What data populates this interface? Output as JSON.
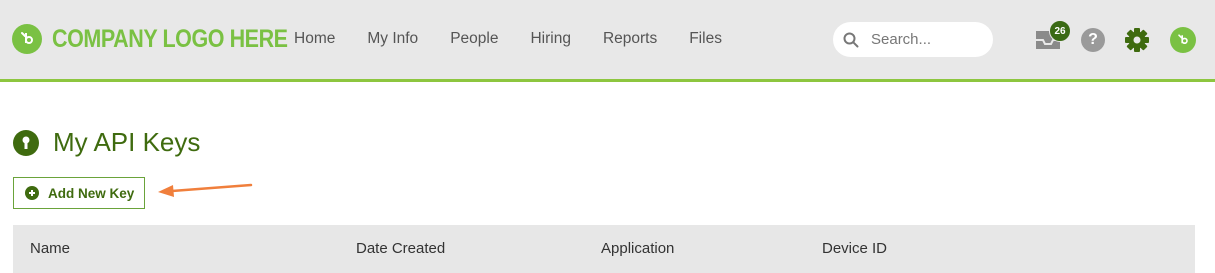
{
  "header": {
    "logo_text": "COMPANY LOGO HERE",
    "nav": [
      "Home",
      "My Info",
      "People",
      "Hiring",
      "Reports",
      "Files"
    ],
    "search_placeholder": "Search...",
    "inbox_count": "26",
    "help_label": "?"
  },
  "page": {
    "title": "My API Keys",
    "add_button_label": "Add New Key"
  },
  "table": {
    "columns": [
      "Name",
      "Date Created",
      "Application",
      "Device ID"
    ]
  },
  "colors": {
    "brand_green": "#7ac143",
    "dark_green": "#3f6b0f",
    "accent_border": "#8dc63f",
    "annotation_arrow": "#f07f3c"
  }
}
